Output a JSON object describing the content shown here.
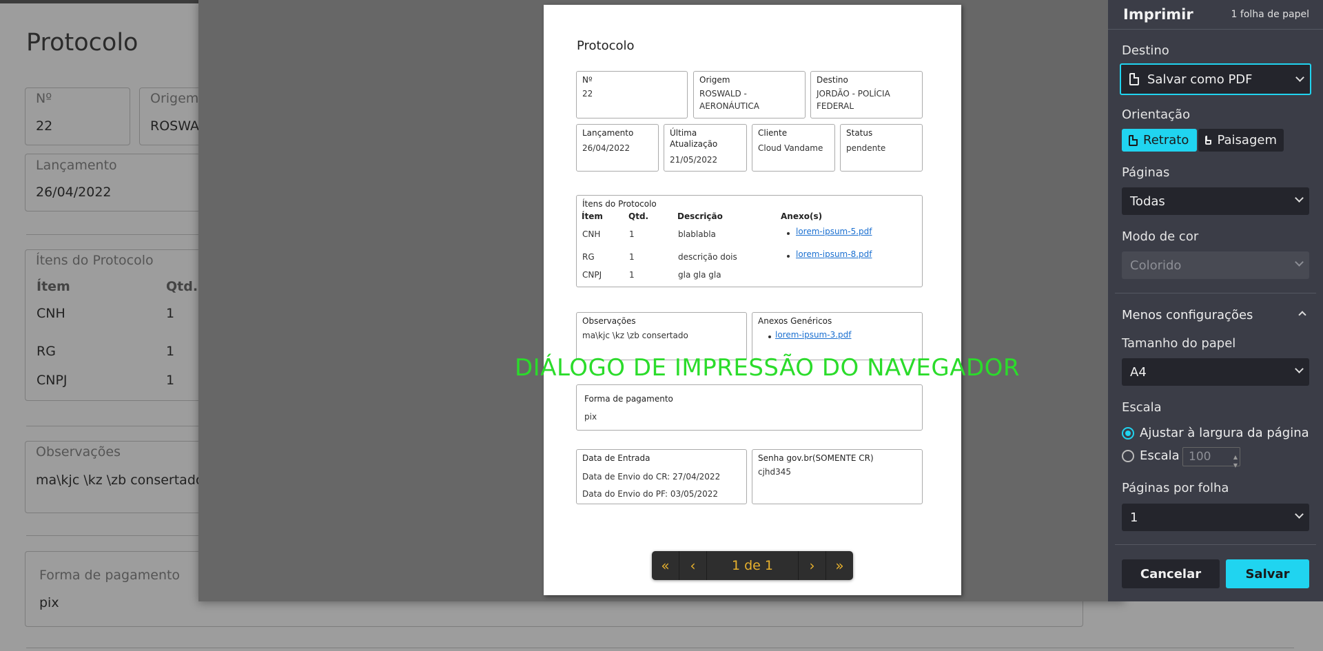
{
  "background": {
    "title": "Protocolo",
    "numero_label": "Nº",
    "numero_value": "22",
    "origem_label": "Origem",
    "origem_value": "ROSWA",
    "lancamento_label": "Lançamento",
    "lancamento_value": "26/04/2022",
    "itens_label": "Ítens do Protocolo",
    "col_item": "Ítem",
    "col_qtd": "Qtd.",
    "rows": [
      {
        "item": "CNH",
        "qtd": "1"
      },
      {
        "item": "RG",
        "qtd": "1"
      },
      {
        "item": "CNPJ",
        "qtd": "1"
      }
    ],
    "observacoes_label": "Observações",
    "observacoes_value": "ma\\kjc \\kz \\zb consertado",
    "pagamento_label": "Forma de pagamento",
    "pagamento_value": "pix"
  },
  "preview": {
    "title": "Protocolo",
    "numero": {
      "label": "Nº",
      "value": "22"
    },
    "origem": {
      "label": "Origem",
      "value1": "ROSWALD -",
      "value2": "AERONÁUTICA"
    },
    "destino": {
      "label": "Destino",
      "value1": "JORDÃO - POLÍCIA",
      "value2": "FEDERAL"
    },
    "lancamento": {
      "label": "Lançamento",
      "value": "26/04/2022"
    },
    "ultima": {
      "label1": "Última",
      "label2": "Atualização",
      "value": "21/05/2022"
    },
    "cliente": {
      "label": "Cliente",
      "value": "Cloud Vandame"
    },
    "status": {
      "label": "Status",
      "value": "pendente"
    },
    "itens": {
      "label": "Ítens do Protocolo",
      "col_item": "Ítem",
      "col_qtd": "Qtd.",
      "col_desc": "Descrição",
      "col_anexo": "Anexo(s)",
      "rows": [
        {
          "item": "CNH",
          "qtd": "1",
          "desc": "blablabla",
          "anexo": "lorem-ipsum-5.pdf"
        },
        {
          "item": "RG",
          "qtd": "1",
          "desc": "descrição dois",
          "anexo": "lorem-ipsum-8.pdf"
        },
        {
          "item": "CNPJ",
          "qtd": "1",
          "desc": "gla gla gla",
          "anexo": ""
        }
      ]
    },
    "observacoes": {
      "label": "Observações",
      "value": "ma\\kjc \\kz \\zb consertado"
    },
    "anexos": {
      "label": "Anexos Genéricos",
      "link": "lorem-ipsum-3.pdf"
    },
    "pagamento": {
      "label": "Forma de pagamento",
      "value": "pix"
    },
    "entrada": {
      "label": "Data de Entrada",
      "envio_cr": "Data de Envio do CR: 27/04/2022",
      "envio_pf": "Data do Envio do PF: 03/05/2022"
    },
    "senha": {
      "label": "Senha gov.br(SOMENTE CR)",
      "value": "cjhd345"
    },
    "pager": {
      "text": "1 de 1"
    }
  },
  "caption": "DIÁLOGO DE IMPRESSÃO DO NAVEGADOR",
  "print_panel": {
    "title": "Imprimir",
    "sheets": "1 folha de papel",
    "destino_label": "Destino",
    "destino_value": "Salvar como PDF",
    "orientacao_label": "Orientação",
    "retrato": "Retrato",
    "paisagem": "Paisagem",
    "paginas_label": "Páginas",
    "paginas_value": "Todas",
    "cor_label": "Modo de cor",
    "cor_value": "Colorido",
    "menos": "Menos configurações",
    "papel_label": "Tamanho do papel",
    "papel_value": "A4",
    "escala_label": "Escala",
    "ajustar": "Ajustar à largura da página",
    "escala_opt": "Escala",
    "escala_value": "100",
    "ppf_label": "Páginas por folha",
    "ppf_value": "1",
    "cancelar": "Cancelar",
    "salvar": "Salvar",
    "accent": "#20d4f0"
  }
}
